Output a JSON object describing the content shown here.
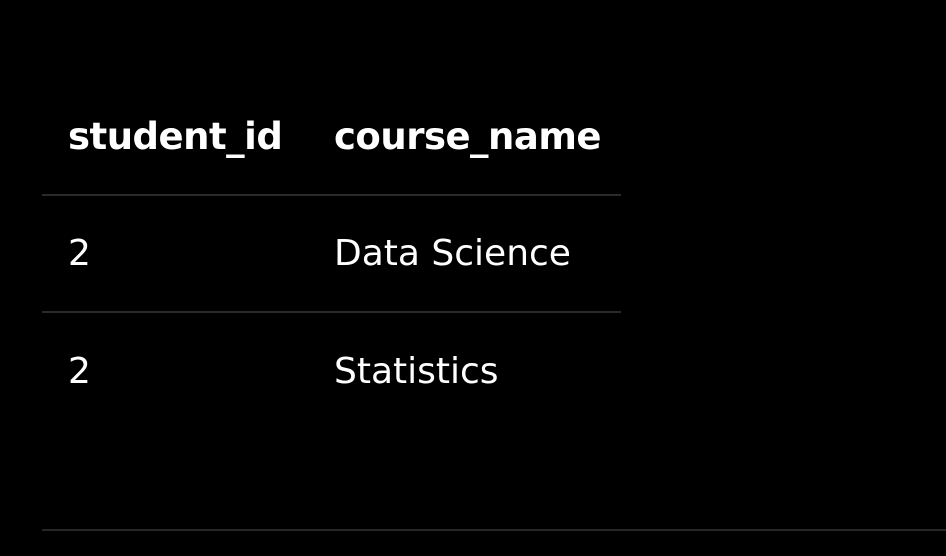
{
  "table": {
    "columns": [
      "student_id",
      "course_name"
    ],
    "rows": [
      {
        "student_id": "2",
        "course_name": "Data Science"
      },
      {
        "student_id": "2",
        "course_name": "Statistics"
      }
    ]
  },
  "colors": {
    "background": "#000000",
    "text": "#ffffff",
    "divider": "#2a2a2a"
  }
}
